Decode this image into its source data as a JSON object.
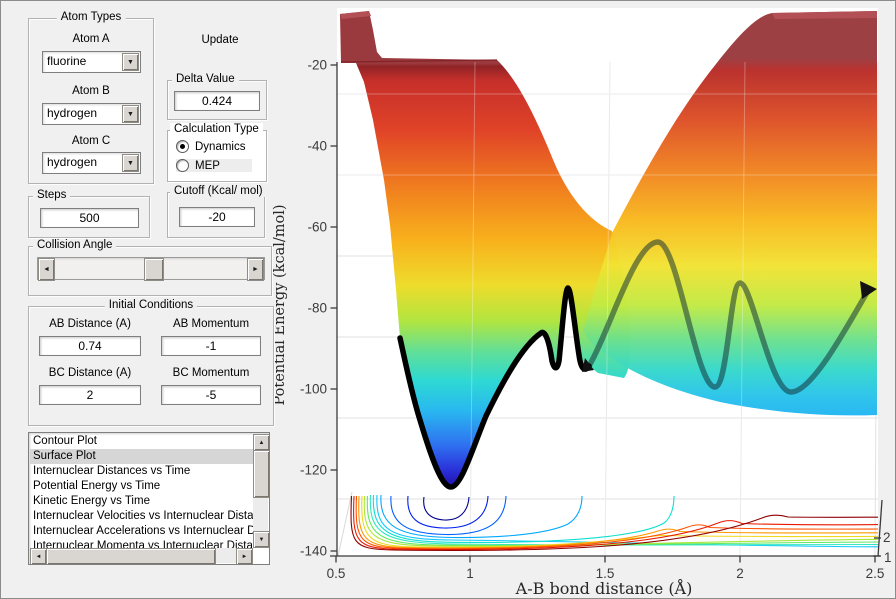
{
  "window": {
    "bg": "#f0f0f0",
    "border": "#8c8c8c"
  },
  "controls": {
    "atom_types": {
      "title": "Atom Types",
      "rows": [
        {
          "label": "Atom A",
          "value": "fluorine"
        },
        {
          "label": "Atom B",
          "value": "hydrogen"
        },
        {
          "label": "Atom C",
          "value": "hydrogen"
        }
      ]
    },
    "update": {
      "label": "Update"
    },
    "delta": {
      "title": "Delta Value",
      "value": "0.424"
    },
    "calc_type": {
      "title": "Calculation Type",
      "options": [
        {
          "label": "Dynamics",
          "selected": true
        },
        {
          "label": "MEP",
          "selected": false
        }
      ]
    },
    "steps": {
      "title": "Steps",
      "value": "500"
    },
    "cutoff": {
      "title": "Cutoff (Kcal/ mol)",
      "value": "-20"
    },
    "collision_angle": {
      "title": "Collision Angle"
    },
    "initial_conditions": {
      "title": "Initial Conditions",
      "fields": [
        {
          "label": "AB Distance (A)",
          "value": "0.74"
        },
        {
          "label": "AB Momentum",
          "value": "-1"
        },
        {
          "label": "BC Distance (A)",
          "value": "2"
        },
        {
          "label": "BC Momentum",
          "value": "-5"
        }
      ]
    },
    "plot_list": {
      "selected": "Surface Plot",
      "items": [
        "Contour Plot",
        "Surface Plot",
        "Internuclear Distances vs Time",
        "Potential Energy vs Time",
        "Kinetic Energy vs Time",
        "Internuclear Velocities vs Internuclear Distance",
        "Internuclear Accelerations vs Internuclear Distance",
        "Internuclear Momenta vs Internuclear Distance"
      ]
    }
  },
  "chart_data": {
    "type": "heatmap",
    "subtype": "3d-potential-energy-surface-with-trajectory-and-contour",
    "title": "",
    "xlabel": "A-B bond distance (Å)",
    "ylabel": "Potential Energy (kcal/mol)",
    "xlim": [
      0.5,
      2.5
    ],
    "ylim": [
      -140,
      -20
    ],
    "xtick_labels": [
      "0.5",
      "1",
      "1.5",
      "2",
      "2.5"
    ],
    "ytick_labels": [
      "-20",
      "-40",
      "-60",
      "-80",
      "-100",
      "-120",
      "-140"
    ],
    "depth_tick_labels": [
      "2",
      "1"
    ],
    "grid": true,
    "colormap": "jet",
    "cutoff_kcal_mol": -20,
    "surface_min_kcal_mol": -124,
    "trajectory": {
      "color": "#000000",
      "points_AB_vs_E": [
        [
          0.73,
          -85
        ],
        [
          0.8,
          -97
        ],
        [
          0.92,
          -124
        ],
        [
          1.05,
          -110
        ],
        [
          1.26,
          -86
        ],
        [
          1.3,
          -93
        ],
        [
          1.36,
          -75
        ],
        [
          1.43,
          -95
        ],
        [
          1.69,
          -64
        ],
        [
          1.9,
          -100
        ],
        [
          1.99,
          -74
        ],
        [
          2.18,
          -101
        ],
        [
          2.48,
          -75
        ]
      ]
    },
    "contour_colors": [
      "#000090",
      "#0020f0",
      "#0060ff",
      "#00a8ff",
      "#10c8ff",
      "#10e0d0",
      "#30e8c0",
      "#60e860",
      "#a8e838",
      "#f0d820",
      "#ff9800",
      "#ff5000",
      "#e81800",
      "#900000"
    ]
  }
}
